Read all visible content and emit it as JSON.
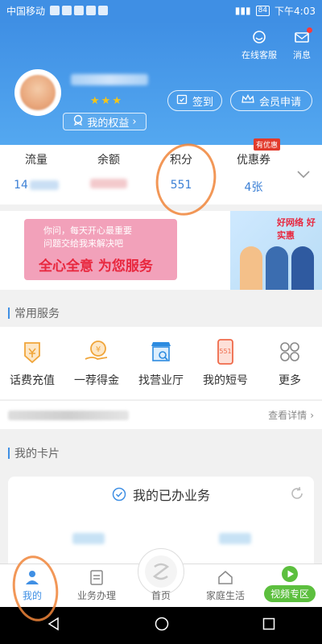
{
  "status_bar": {
    "carrier": "中国移动",
    "battery": "84",
    "time": "下午4:03"
  },
  "header": {
    "online_service_label": "在线客服",
    "messages_label": "消息",
    "rights_label": "我的权益",
    "signin_label": "签到",
    "member_label": "会员申请"
  },
  "stats": [
    {
      "label": "流量",
      "value": "14"
    },
    {
      "label": "余额",
      "value": ""
    },
    {
      "label": "积分",
      "value": "551"
    },
    {
      "label": "优惠券",
      "value": "4张",
      "badge": "有优惠"
    }
  ],
  "banner": {
    "line1": "你问，每天开心最重要",
    "line2": "问题交给我来解决吧",
    "slogan": "全心全意 为您服务",
    "logo": "好网络 好实惠"
  },
  "common_services": {
    "title": "常用服务",
    "items": [
      {
        "label": "话费充值",
        "icon": "wallet-icon"
      },
      {
        "label": "一荐得金",
        "icon": "coin-hand-icon"
      },
      {
        "label": "找营业厅",
        "icon": "store-search-icon"
      },
      {
        "label": "我的短号",
        "icon": "phone-551-icon"
      },
      {
        "label": "更多",
        "icon": "grid-icon"
      }
    ]
  },
  "notice": {
    "details_label": "查看详情"
  },
  "my_cards": {
    "title": "我的卡片",
    "card_title": "我的已办业务"
  },
  "tab_bar": {
    "items": [
      {
        "label": "我的",
        "active": true
      },
      {
        "label": "业务办理",
        "active": false
      },
      {
        "label": "首页",
        "active": false
      },
      {
        "label": "家庭生活",
        "active": false
      },
      {
        "label": "视频专区",
        "active": false
      }
    ]
  },
  "colors": {
    "brand_blue": "#3f8fe4",
    "value_blue": "#3a7fd5",
    "accent_orange": "#f0853a",
    "video_green": "#5cbf3e"
  }
}
